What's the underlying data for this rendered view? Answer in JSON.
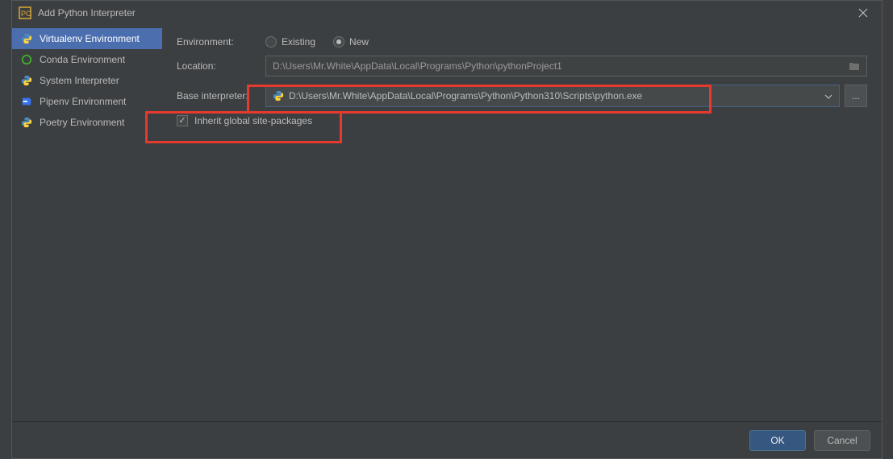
{
  "window": {
    "title": "Add Python Interpreter"
  },
  "sidebar": {
    "items": [
      {
        "label": "Virtualenv Environment"
      },
      {
        "label": "Conda Environment"
      },
      {
        "label": "System Interpreter"
      },
      {
        "label": "Pipenv Environment"
      },
      {
        "label": "Poetry Environment"
      }
    ]
  },
  "form": {
    "environment_label": "Environment:",
    "existing_label": "Existing",
    "new_label": "New",
    "location_label": "Location:",
    "location_value": "D:\\Users\\Mr.White\\AppData\\Local\\Programs\\Python\\pythonProject1",
    "base_label": "Base interpreter:",
    "base_value": "D:\\Users\\Mr.White\\AppData\\Local\\Programs\\Python\\Python310\\Scripts\\python.exe",
    "inherit_label": "Inherit global site-packages",
    "ellipsis": "..."
  },
  "footer": {
    "ok": "OK",
    "cancel": "Cancel"
  }
}
